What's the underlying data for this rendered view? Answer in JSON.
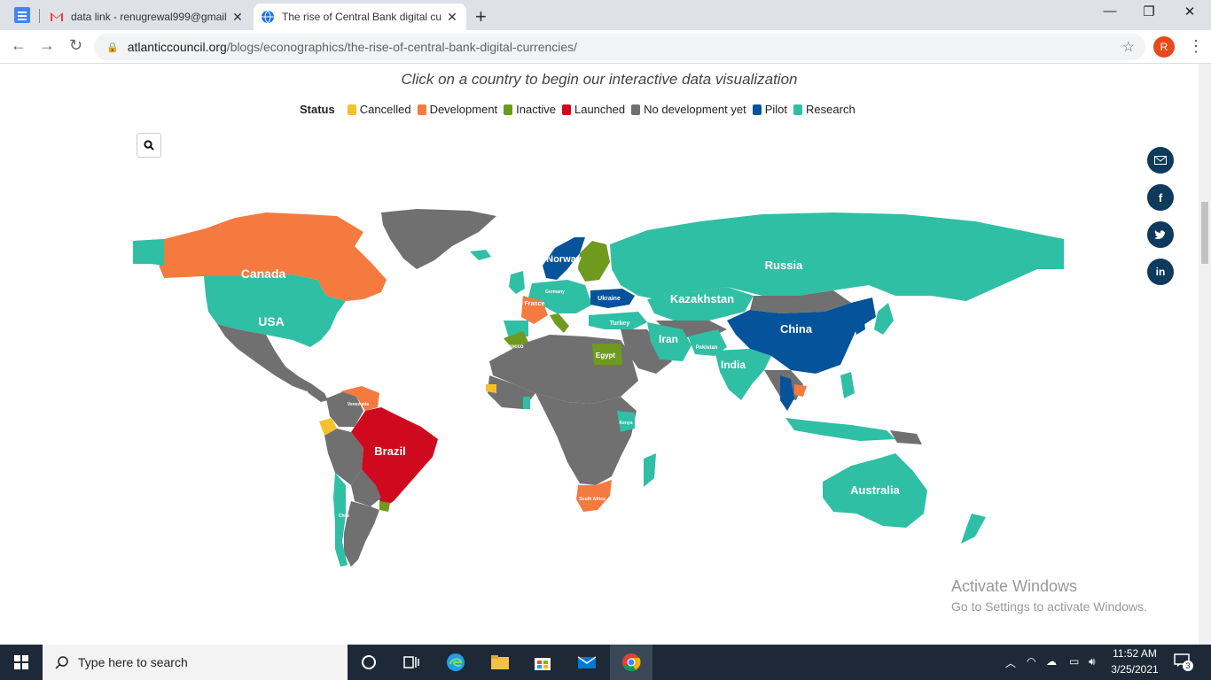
{
  "browser": {
    "tabs": [
      {
        "title": "data link - renugrewal999@gmail",
        "active": false
      },
      {
        "title": "The rise of Central Bank digital cu",
        "active": true
      }
    ],
    "url_host": "atlanticcouncil.org",
    "url_path": "/blogs/econographics/the-rise-of-central-bank-digital-currencies/",
    "profile_initial": "R"
  },
  "page": {
    "subtitle": "Click on a country to begin our interactive data visualization",
    "legend_title": "Status",
    "legend": [
      {
        "label": "Cancelled",
        "color": "#f7c12c"
      },
      {
        "label": "Development",
        "color": "#f47a3f"
      },
      {
        "label": "Inactive",
        "color": "#6e9a1e"
      },
      {
        "label": "Launched",
        "color": "#cf0a1e"
      },
      {
        "label": "No development yet",
        "color": "#707070"
      },
      {
        "label": "Pilot",
        "color": "#05539a"
      },
      {
        "label": "Research",
        "color": "#2fbfa4"
      }
    ],
    "map_labels": {
      "canada": "Canada",
      "usa": "USA",
      "brazil": "Brazil",
      "russia": "Russia",
      "kazakhstan": "Kazakhstan",
      "china": "China",
      "iran": "Iran",
      "india": "India",
      "australia": "Australia",
      "ukraine": "Ukraine",
      "turkey": "Turkey",
      "egypt": "Egypt",
      "norway": "Norway",
      "france": "France",
      "pakistan": "Pakistan",
      "kenya": "Kenya",
      "south_africa": "South Africa",
      "morocco": "Morocco",
      "venezuela": "Venezuela",
      "chile": "Chile",
      "germany": "Germany"
    },
    "activate_title": "Activate Windows",
    "activate_sub": "Go to Settings to activate Windows."
  },
  "taskbar": {
    "search_placeholder": "Type here to search",
    "time": "11:52 AM",
    "date": "3/25/2021",
    "notification_count": "3"
  }
}
